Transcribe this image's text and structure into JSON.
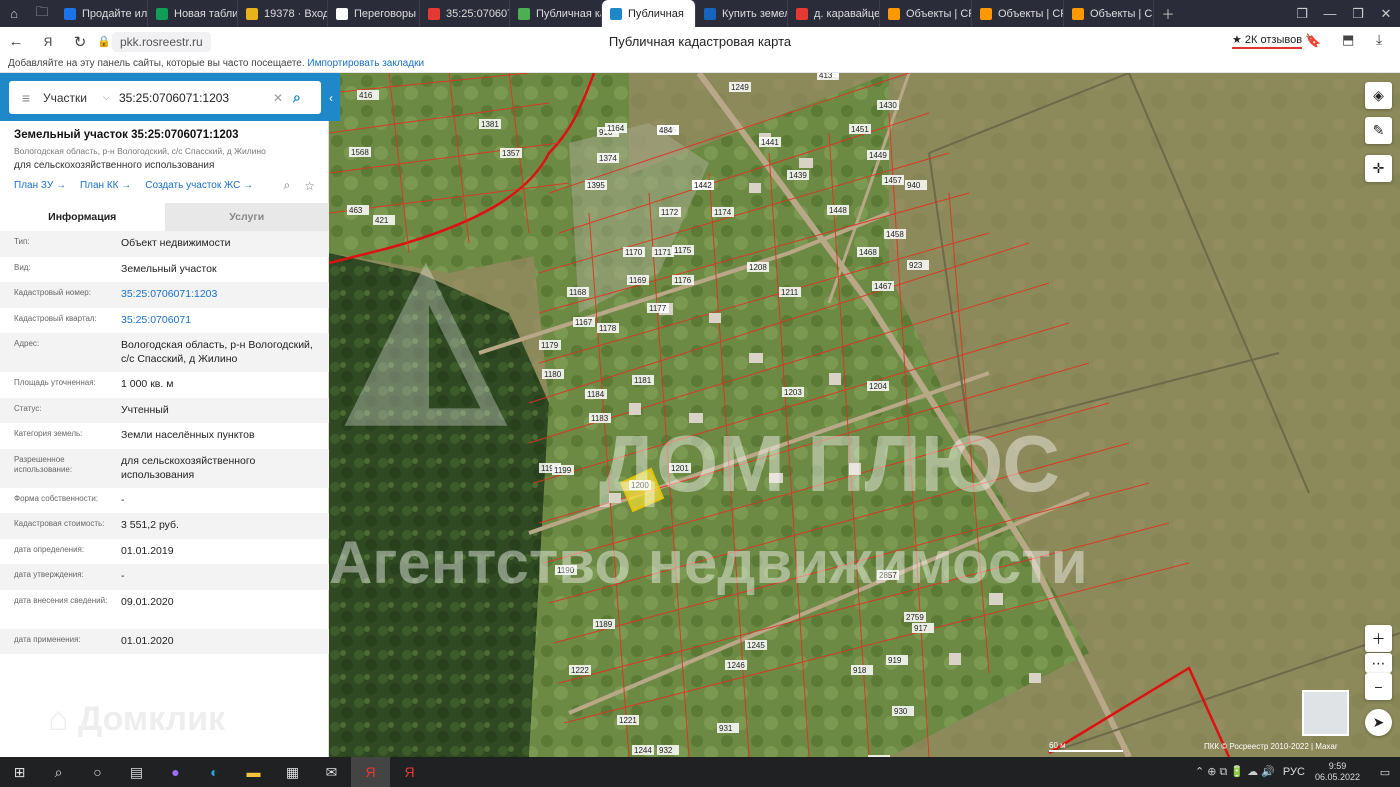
{
  "browser": {
    "tabs": [
      {
        "label": "Продайте или",
        "color": "#1a73e8"
      },
      {
        "label": "Новая таблиц",
        "color": "#0f9d58"
      },
      {
        "label": "19378 · Входя",
        "color": "#e8b21a"
      },
      {
        "label": "Переговоры с",
        "color": "#ffffff"
      },
      {
        "label": "35:25:070607",
        "color": "#e53935"
      },
      {
        "label": "Публичная ка",
        "color": "#4caf50"
      },
      {
        "label": "Публичная",
        "color": "#1e88c8"
      },
      {
        "label": "Купить земел",
        "color": "#1565c0"
      },
      {
        "label": "д. каравайцев",
        "color": "#e53935"
      },
      {
        "label": "Объекты | CR",
        "color": "#ff9800"
      },
      {
        "label": "Объекты | CR",
        "color": "#ff9800"
      },
      {
        "label": "Объекты | CR",
        "color": "#ff9800"
      }
    ],
    "url": "pkk.rosreestr.ru",
    "page_title": "Публичная кадастровая карта",
    "reviews": "★ 2К отзывов",
    "bookmarks_hint": "Добавляйте на эту панель сайты, которые вы часто посещаете.",
    "bookmarks_link": "Импортировать закладки"
  },
  "search": {
    "type": "Участки",
    "query": "35:25:0706071:1203"
  },
  "parcel": {
    "title": "Земельный участок 35:25:0706071:1203",
    "address_short": "Вологодская область, р-н Вологодский, с/с Спасский, д Жилино",
    "use": "для сельскохозяйственного использования",
    "links": [
      "План ЗУ →",
      "План КК →",
      "Создать участок ЖС →"
    ],
    "tabs": [
      "Информация",
      "Услуги"
    ],
    "fields": [
      {
        "k": "Тип:",
        "v": "Объект недвижимости"
      },
      {
        "k": "Вид:",
        "v": "Земельный участок"
      },
      {
        "k": "Кадастровый номер:",
        "v": "35:25:0706071:1203",
        "link": true
      },
      {
        "k": "Кадастровый квартал:",
        "v": "35:25:0706071",
        "link": true
      },
      {
        "k": "Адрес:",
        "v": "Вологодская область, р-н Вологодский, с/с Спасский, д Жилино"
      },
      {
        "k": "Площадь уточненная:",
        "v": "1 000 кв. м"
      },
      {
        "k": "Статус:",
        "v": "Учтенный"
      },
      {
        "k": "Категория земель:",
        "v": "Земли населённых пунктов"
      },
      {
        "k": "Разрешенное использование:",
        "v": "для сельскохозяйственного использования"
      },
      {
        "k": "Форма собственности:",
        "v": "-"
      },
      {
        "k": "Кадастровая стоимость:",
        "v": "3 551,2 руб."
      },
      {
        "k": "дата определения:",
        "v": "01.01.2019"
      },
      {
        "k": "дата утверждения:",
        "v": "-"
      },
      {
        "k": "дата внесения сведений:",
        "v": "09.01.2020"
      },
      {
        "k": "дата применения:",
        "v": "01.01.2020"
      }
    ]
  },
  "map": {
    "watermark1": "ДОМ ПЛЮС",
    "watermark2": "Агентство недвижимости",
    "domclick": "Домклик",
    "scale": "60 м",
    "copyright": "ПКК © Росреестр 2010-2022 | Maxar",
    "plots": [
      "1166",
      "1173",
      "1172",
      "1174",
      "1171",
      "1175",
      "1170",
      "1176",
      "1169",
      "1177",
      "1168",
      "1178",
      "1167",
      "1179",
      "1180",
      "1181",
      "1184",
      "1183",
      "1196",
      "1199",
      "1200",
      "1201",
      "1203",
      "1204",
      "1208",
      "1211",
      "1189",
      "1190",
      "1222",
      "1221",
      "1244",
      "1246",
      "1245",
      "1249",
      "1250",
      "1430",
      "1441",
      "1451",
      "1439",
      "1449",
      "1448",
      "1457",
      "1458",
      "1468",
      "1467",
      "2857",
      "2759",
      "917",
      "918",
      "919",
      "930",
      "931",
      "932",
      "922",
      "923",
      "940",
      "916",
      "1164",
      "1374",
      "1395",
      "1381",
      "1357",
      "1568",
      "463",
      "421",
      "416",
      "413",
      "484",
      "1442"
    ]
  },
  "taskbar": {
    "lang": "РУС",
    "time": "9:59",
    "date": "06.05.2022"
  }
}
